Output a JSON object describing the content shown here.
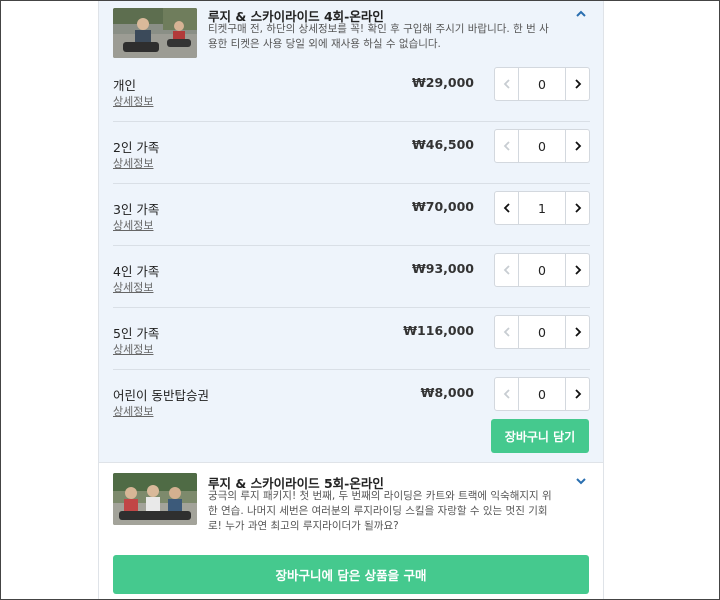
{
  "product1": {
    "title": "루지 & 스카이라이드 4회-온라인",
    "description": "티켓구매 전, 하단의 상세정보를 꼭! 확인 후 구입해 주시기 바랍니다. 한 번 사용한 티켓은 사용 당일 외에 재사용 하실 수 없습니다.",
    "collapse_icon": "chevron-up-icon",
    "detail_link": "상세정보",
    "tickets": [
      {
        "label": "개인",
        "price": "₩29,000",
        "qty": "0"
      },
      {
        "label": "2인 가족",
        "price": "₩46,500",
        "qty": "0"
      },
      {
        "label": "3인 가족",
        "price": "₩70,000",
        "qty": "1"
      },
      {
        "label": "4인 가족",
        "price": "₩93,000",
        "qty": "0"
      },
      {
        "label": "5인 가족",
        "price": "₩116,000",
        "qty": "0"
      },
      {
        "label": "어린이 동반탑승권",
        "price": "₩8,000",
        "qty": "0"
      }
    ],
    "add_to_cart_label": "장바구니 담기"
  },
  "product2": {
    "title": "루지 & 스카이라이드 5회-온라인",
    "description": "궁극의 루지 패키지! 첫 번째, 두 번째의 라이딩은 카트와 트랙에 익숙해지지 위한 연습. 나머지 세번은 여러분의 루지라이딩 스킬을 자랑할 수 있는 멋진 기회로! 누가 과연 최고의 루지라이더가 될까요?",
    "expand_icon": "chevron-down-icon"
  },
  "purchase_label": "장바구니에 담은 상품을 구매",
  "colors": {
    "accent_green": "#45c98e",
    "panel_bg": "#eef4fb",
    "chevron_blue": "#2a6fb0"
  }
}
